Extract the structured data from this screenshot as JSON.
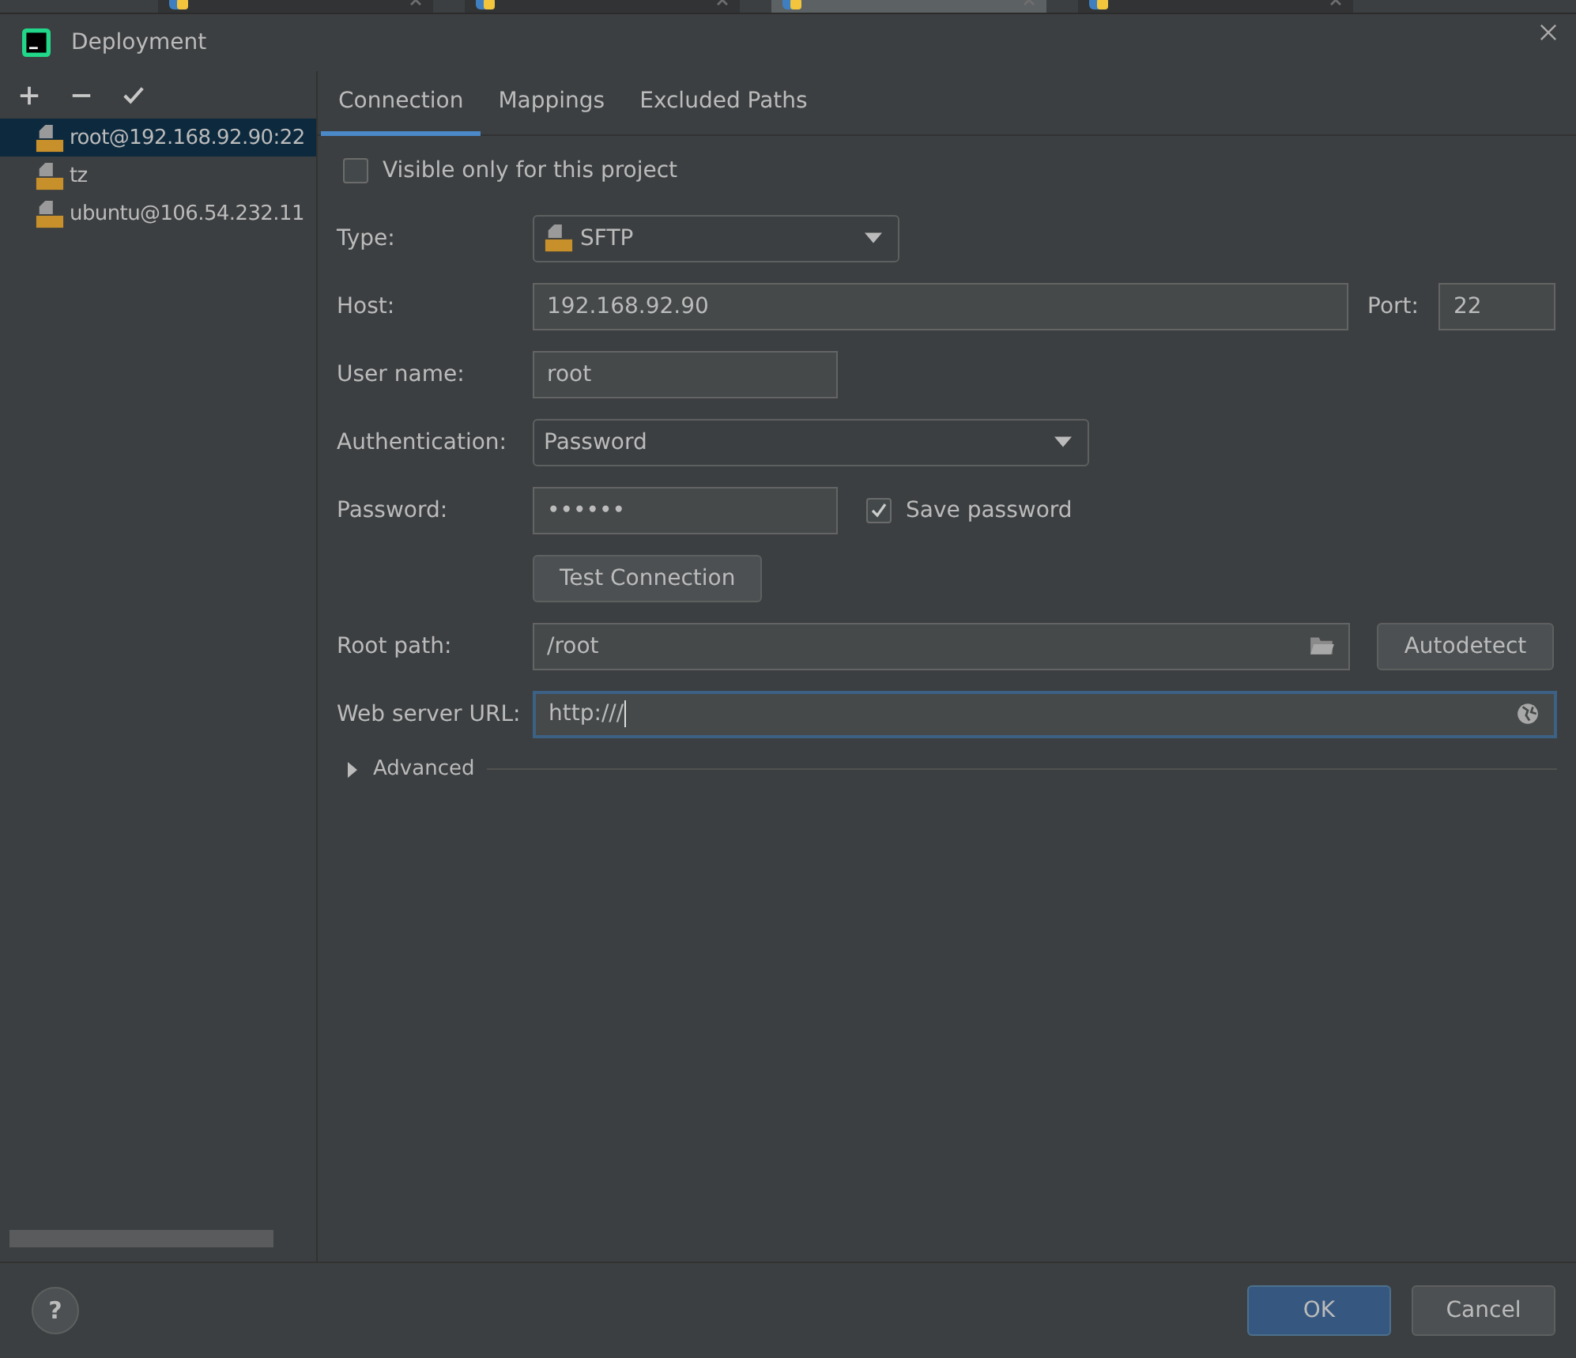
{
  "editor_tabs": [
    {
      "selected": false
    },
    {
      "selected": false
    },
    {
      "selected": true
    },
    {
      "selected": false
    }
  ],
  "window": {
    "title": "Deployment"
  },
  "servers": [
    {
      "name": "root@192.168.92.90:22",
      "selected": true
    },
    {
      "name": "tz",
      "selected": false
    },
    {
      "name": "ubuntu@106.54.232.11",
      "selected": false
    }
  ],
  "tabs": [
    {
      "label": "Connection",
      "selected": true
    },
    {
      "label": "Mappings",
      "selected": false
    },
    {
      "label": "Excluded Paths",
      "selected": false
    }
  ],
  "visible_only": {
    "label": "Visible only for this project",
    "checked": false
  },
  "type": {
    "label": "Type:",
    "value": "SFTP"
  },
  "host": {
    "label": "Host:",
    "value": "192.168.92.90"
  },
  "port": {
    "label": "Port:",
    "value": "22"
  },
  "user_name": {
    "label": "User name:",
    "value": "root"
  },
  "authentication": {
    "label": "Authentication:",
    "value": "Password"
  },
  "password": {
    "label": "Password:",
    "value": "••••••"
  },
  "save_password": {
    "label": "Save password",
    "checked": true
  },
  "test_connection": "Test Connection",
  "root_path": {
    "label": "Root path:",
    "value": "/root"
  },
  "autodetect": "Autodetect",
  "web_server_url": {
    "label": "Web server URL:",
    "value": "http:///"
  },
  "advanced": {
    "label": "Advanced",
    "expanded": false
  },
  "help": "?",
  "ok": "OK",
  "cancel": "Cancel"
}
